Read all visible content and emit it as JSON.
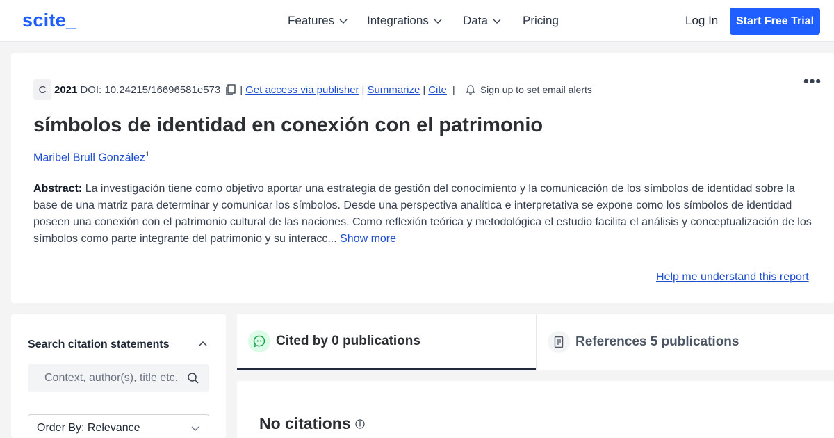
{
  "nav": {
    "logo": "scite_",
    "items": [
      {
        "label": "Features",
        "has_dropdown": true
      },
      {
        "label": "Integrations",
        "has_dropdown": true
      },
      {
        "label": "Data",
        "has_dropdown": true
      },
      {
        "label": "Pricing",
        "has_dropdown": false
      }
    ],
    "login": "Log In",
    "cta": "Start Free Trial"
  },
  "report": {
    "badge": "C",
    "year": "2021",
    "doi": "DOI: 10.24215/16696581e573",
    "links": {
      "access": "Get access via publisher",
      "summarize": "Summarize",
      "cite": "Cite"
    },
    "separator": "|",
    "alerts": "Sign up to set email alerts",
    "title": "símbolos de identidad en conexión con el patrimonio",
    "author": "Maribel Brull González",
    "author_sup": "1",
    "abstract_label": "Abstract:",
    "abstract_text": "La investigación tiene como objetivo aportar una estrategia de gestión del conocimiento y la comunicación de los símbolos de identidad sobre la base de una matriz para determinar y comunicar los símbolos. Desde una perspectiva analítica e interpretativa se expone como los símbolos de identidad poseen una conexión con el patrimonio cultural de las naciones. Como reflexión teórica y metodológica el estudio facilita el análisis y conceptualización de los símbolos como parte integrante del patrimonio y su interacc...",
    "show_more": "Show more",
    "help": "Help me understand this report"
  },
  "sidebar": {
    "search_heading": "Search citation statements",
    "search_placeholder": "Context, author(s), title etc.",
    "order_by": "Order By: Relevance"
  },
  "tabs": [
    {
      "label": "Cited by 0 publications",
      "active": true,
      "icon": "quote-bubble-icon"
    },
    {
      "label": "References 5 publications",
      "active": false,
      "icon": "document-icon"
    }
  ],
  "results": {
    "empty_title": "No citations"
  },
  "colors": {
    "brand": "#1f5eff",
    "link": "#1f4fd1",
    "cited_icon_bg": "#dcfce7",
    "cited_icon_fg": "#16a34a"
  }
}
